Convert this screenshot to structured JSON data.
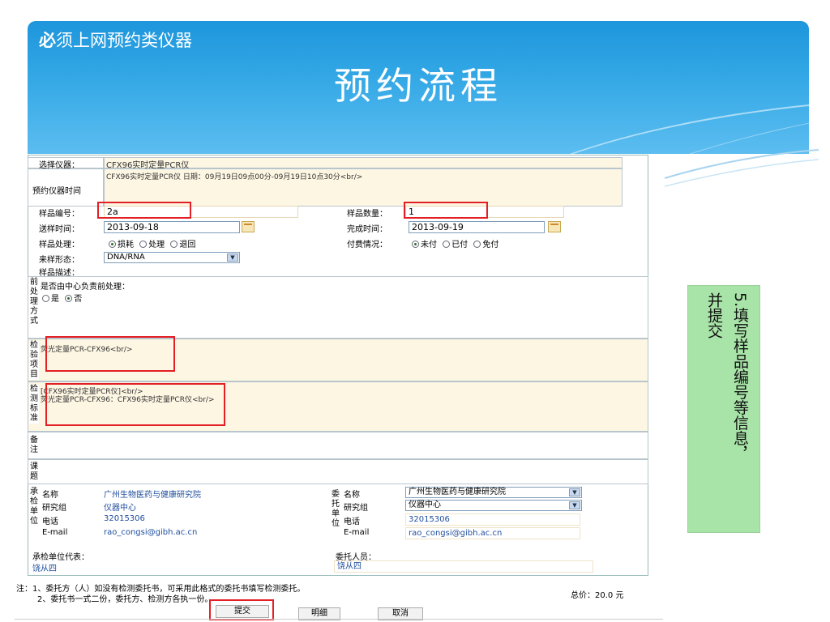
{
  "header": {
    "subtitle_bold": "必",
    "subtitle_rest": "须上网预约类仪器",
    "title": "预约流程"
  },
  "form": {
    "instrument_label": "选择仪器：",
    "instrument_value": "CFX96实时定量PCR仪",
    "time_label": "预约仪器时间",
    "time_value": "CFX96实时定量PCR仪  日期：09月19日09点00分-09月19日10点30分<br/>",
    "sample_no_label": "样品编号：",
    "sample_no_value": "2a",
    "sample_qty_label": "样品数量：",
    "sample_qty_value": "1",
    "send_time_label": "送样时间：",
    "send_time_value": "2013-09-18",
    "finish_time_label": "完成时间：",
    "finish_time_value": "2013-09-19",
    "treatment_label": "样品处理：",
    "treatment_options": [
      "损耗",
      "处理",
      "退回"
    ],
    "payment_label": "付费情况：",
    "payment_options": [
      "未付",
      "已付",
      "免付"
    ],
    "state_label": "来样形态：",
    "state_value": "DNA/RNA",
    "desc_label": "样品描述：",
    "pre_label": "前处理方式",
    "pre_question": "是否由中心负责前处理：",
    "pre_options": [
      "是",
      "否"
    ],
    "test_item_label": "检验项目",
    "test_item_value": "荧光定量PCR-CFX96<br/>",
    "test_std_label": "检测标准",
    "test_std_line1": "[CFX96实时定量PCR仪]<br/>",
    "test_std_line2": "荧光定量PCR-CFX96：CFX96实时定量PCR仪<br/>",
    "remark_label": "备注",
    "subject_label": "课题",
    "undertake_label": "承检单位",
    "entrust_label": "委托单位",
    "name_label": "名称",
    "group_label": "研究组",
    "phone_label": "电话",
    "email_label": "E-mail",
    "left_name": "广州生物医药与健康研究院",
    "left_group": "仪器中心",
    "left_phone": "32015306",
    "left_email": "rao_congsi@gibh.ac.cn",
    "right_name": "广州生物医药与健康研究院",
    "right_group": "仪器中心",
    "right_phone": "32015306",
    "right_email": "rao_congsi@gibh.ac.cn",
    "rep_label": "承检单位代表：",
    "rep_value": "饶从四",
    "client_label": "委托人员：",
    "client_value": "饶从四",
    "note1": "注：1、委托方（人）如没有检测委托书，可采用此格式的委托书填写检测委托。",
    "note2": "2、委托书一式二份，委托方、检测方各执一份。",
    "total": "总价：20.0 元",
    "submit": "提交",
    "detail": "明细",
    "cancel": "取消"
  },
  "side_note": {
    "col1": "5.填写样品编号等信息，",
    "col2": "并提交"
  }
}
